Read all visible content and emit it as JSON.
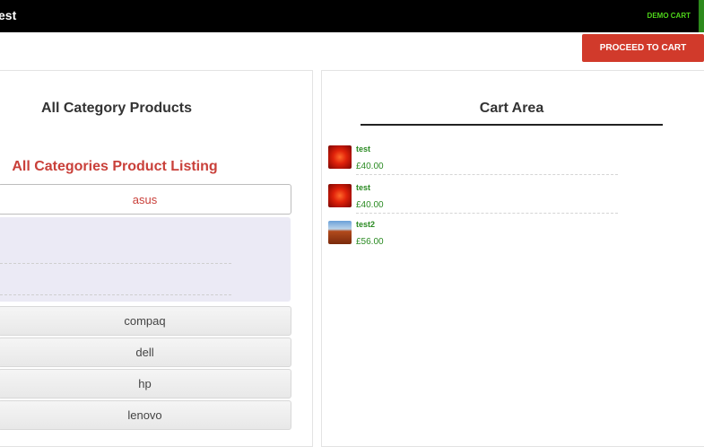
{
  "header": {
    "brand": "est",
    "demo_cart": "DEMO CART"
  },
  "actions": {
    "proceed_to_cart": "PROCEED TO CART"
  },
  "left": {
    "title": "All Category Products",
    "listing_title": "All Categories Product Listing",
    "active_category": "asus",
    "categories": [
      "compaq",
      "dell",
      "hp",
      "lenovo"
    ]
  },
  "cart": {
    "title": "Cart Area",
    "items": [
      {
        "name": "test",
        "price": "£40.00",
        "thumb": "flower-image"
      },
      {
        "name": "test",
        "price": "£40.00",
        "thumb": "flower-image"
      },
      {
        "name": "test2",
        "price": "£56.00",
        "thumb": "landscape-image"
      }
    ]
  },
  "colors": {
    "accent_red": "#d13a2b",
    "listing_red": "#c9403a",
    "price_green": "#2a8a22",
    "demo_green": "#4ed41a"
  }
}
